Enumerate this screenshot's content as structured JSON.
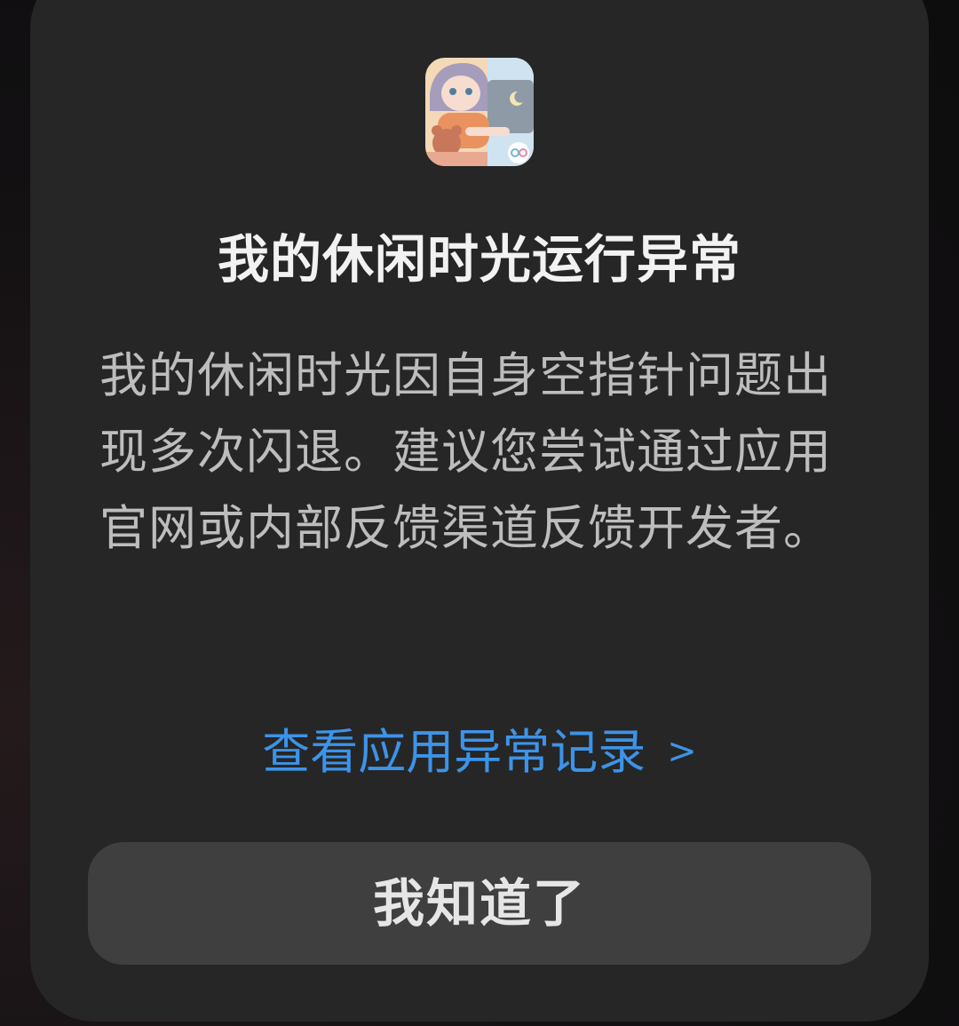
{
  "dialog": {
    "app_icon": "casual-time-game-icon",
    "title": "我的休闲时光运行异常",
    "message": "我的休闲时光因自身空指针问题出现多次闪退。建议您尝试通过应用官网或内部反馈渠道反馈开发者。",
    "view_log_label": "查看应用异常记录",
    "view_log_chevron": ">",
    "ok_button_label": "我知道了"
  },
  "colors": {
    "dialog_background": "#262626",
    "title_text": "#f2f2f2",
    "body_text": "#bdbdbd",
    "link_accent": "#3d93e8",
    "button_background": "#3f3f3f"
  }
}
